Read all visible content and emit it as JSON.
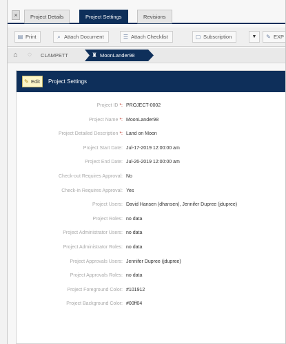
{
  "tabs": [
    {
      "label": "Project Details"
    },
    {
      "label": "Project Settings"
    },
    {
      "label": "Revisions"
    }
  ],
  "toolbar": {
    "print": "Print",
    "attach_document": "Attach Document",
    "attach_checklist": "Attach Checklist",
    "subscription": "Subscription",
    "exp": "EXP"
  },
  "breadcrumb": {
    "parent": "CLAMPETT",
    "current": "MoonLander98"
  },
  "panel": {
    "edit_label": "Edit",
    "title": "Project Settings"
  },
  "fields": [
    {
      "label": "Project ID",
      "required": true,
      "value": "PROJECT-0002"
    },
    {
      "label": "Project Name",
      "required": true,
      "value": "MoonLander98"
    },
    {
      "label": "Project Detailed Description",
      "required": true,
      "value": "Land on Moon"
    },
    {
      "label": "Project Start Date:",
      "required": false,
      "value": "Jul-17-2019 12:00:00 am"
    },
    {
      "label": "Project End Date:",
      "required": false,
      "value": "Jul-26-2019 12:00:00 am"
    },
    {
      "label": "Check-out Requires Approval:",
      "required": false,
      "value": "No"
    },
    {
      "label": "Check-in Requires Approval:",
      "required": false,
      "value": "Yes"
    },
    {
      "label": "Project Users:",
      "required": false,
      "value": "David Hansen (dhansen), Jennifer Dupree (jdupree)"
    },
    {
      "label": "Project Roles:",
      "required": false,
      "value": "no data"
    },
    {
      "label": "Project Administrator Users:",
      "required": false,
      "value": "no data"
    },
    {
      "label": "Project Administrator Roles:",
      "required": false,
      "value": "no data"
    },
    {
      "label": "Project Approvals Users:",
      "required": false,
      "value": "Jennifer Dupree (jdupree)"
    },
    {
      "label": "Project Approvals Roles:",
      "required": false,
      "value": "no data"
    },
    {
      "label": "Project Foreground Color:",
      "required": false,
      "value": "#101912"
    },
    {
      "label": "Project Background Color:",
      "required": false,
      "value": "#00ff04"
    }
  ],
  "colors": {
    "accent": "#0e2f5a",
    "edit_button": "#fdf6c8",
    "required_marker": "#c0392b"
  },
  "icons": {
    "tab_close": "close-icon",
    "print": "printer-icon",
    "attach_document": "paperclip-icon",
    "attach_checklist": "checklist-icon",
    "subscription": "subscription-icon",
    "exp": "pencil-icon",
    "home": "home-icon",
    "breadcrumb_parent": "folder-icon",
    "breadcrumb_current": "project-icon",
    "edit": "pencil-icon"
  }
}
